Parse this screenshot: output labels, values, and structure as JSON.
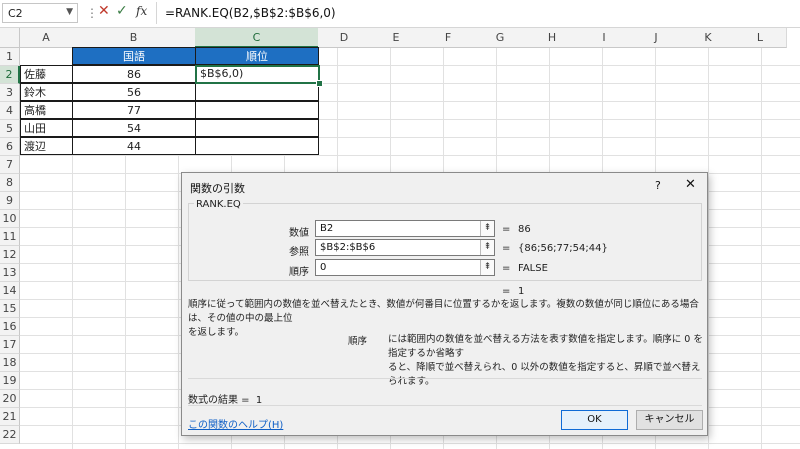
{
  "formula_bar": {
    "name_box": "C2",
    "cancel_icon": "✕",
    "enter_icon": "✓",
    "fx_label": "fx",
    "formula": "=RANK.EQ(B2,$B$2:$B$6,0)"
  },
  "columns": [
    "A",
    "B",
    "C",
    "D",
    "E",
    "F",
    "G",
    "H",
    "I",
    "J",
    "K",
    "L"
  ],
  "rows": [
    "1",
    "2",
    "3",
    "4",
    "5",
    "6",
    "7",
    "8",
    "9",
    "10",
    "11",
    "12",
    "13",
    "14",
    "15",
    "16",
    "17",
    "18",
    "19",
    "20",
    "21",
    "22"
  ],
  "sheet": {
    "header_b": "国語",
    "header_c": "順位",
    "names": [
      "佐藤",
      "鈴木",
      "高橋",
      "山田",
      "渡辺"
    ],
    "scores": [
      "86",
      "56",
      "77",
      "54",
      "44"
    ],
    "active_cell_text": "$B$6,0)"
  },
  "dialog": {
    "title": "関数の引数",
    "help_btn": "?",
    "close_btn": "✕",
    "function_name": "RANK.EQ",
    "args": [
      {
        "label": "数値",
        "value": "B2",
        "result": "86"
      },
      {
        "label": "参照",
        "value": "$B$2:$B$6",
        "result": "{86;56;77;54;44}"
      },
      {
        "label": "順序",
        "value": "0",
        "result": "FALSE"
      }
    ],
    "arg_button_icon": "⇞",
    "equals": "=",
    "formula_result_inline": "1",
    "description_line1": "順序に従って範囲内の数値を並べ替えたとき、数値が何番目に位置するかを返します。複数の数値が同じ順位にある場合は、その値の中の最上位",
    "description_line2": "を返します。",
    "arg_desc_name": "順序",
    "arg_desc_line1": "には範囲内の数値を並べ替える方法を表す数値を指定します。順序に 0 を指定するか省略す",
    "arg_desc_line2": "ると、降順で並べ替えられ、0 以外の数値を指定すると、昇順で並べ替えられます。",
    "result_label": "数式の結果 =",
    "result_value": "1",
    "help_link": "この関数のヘルプ(H)",
    "ok_label": "OK",
    "cancel_label": "キャンセル"
  }
}
